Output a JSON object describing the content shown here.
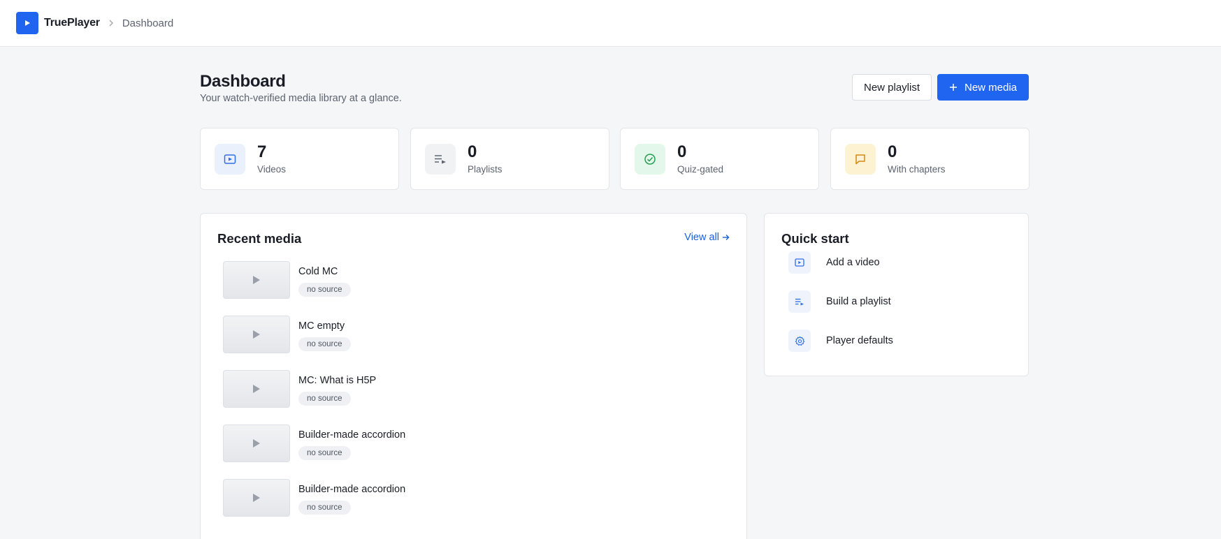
{
  "header": {
    "brand": "TruePlayer",
    "breadcrumb": "Dashboard",
    "brand_color": "#2065f0"
  },
  "page": {
    "title": "Dashboard",
    "subtitle": "Your watch-verified media library at a glance."
  },
  "actions": {
    "new_playlist": "New playlist",
    "new_media": "New media"
  },
  "stats": [
    {
      "value": "7",
      "label": "Videos",
      "icon": "video-icon",
      "color": "#2f6fe4",
      "bg": "#eaf1fd"
    },
    {
      "value": "0",
      "label": "Playlists",
      "icon": "playlist-icon",
      "color": "#5d6470",
      "bg": "#f1f2f4"
    },
    {
      "value": "0",
      "label": "Quiz-gated",
      "icon": "check-circle-icon",
      "color": "#22a052",
      "bg": "#e3f8ea"
    },
    {
      "value": "0",
      "label": "With chapters",
      "icon": "chat-bubble-icon",
      "color": "#d58a12",
      "bg": "#fdf2d2"
    }
  ],
  "recent": {
    "title": "Recent media",
    "view_all": "View all",
    "items": [
      {
        "title": "Cold MC",
        "badge": "no source"
      },
      {
        "title": "MC empty",
        "badge": "no source"
      },
      {
        "title": "MC: What is H5P",
        "badge": "no source"
      },
      {
        "title": "Builder-made accordion",
        "badge": "no source"
      },
      {
        "title": "Builder-made accordion",
        "badge": "no source"
      }
    ]
  },
  "quick_start": {
    "title": "Quick start",
    "items": [
      {
        "label": "Add a video",
        "icon": "video-icon"
      },
      {
        "label": "Build a playlist",
        "icon": "playlist-icon"
      },
      {
        "label": "Player defaults",
        "icon": "gear-icon"
      }
    ]
  }
}
